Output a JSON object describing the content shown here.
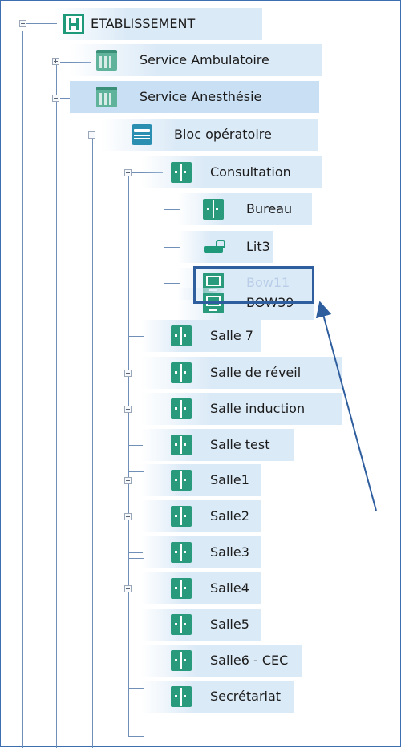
{
  "tree": {
    "root": {
      "label": "ETABLISSEMENT",
      "icon": "hospital-icon"
    },
    "services": [
      {
        "label": "Service Ambulatoire",
        "icon": "building-icon",
        "expanded": false
      },
      {
        "label": "Service Anesthésie",
        "icon": "building-icon",
        "expanded": true
      }
    ],
    "bloc": {
      "label": "Bloc opératoire",
      "icon": "operating-block-icon"
    },
    "consultation": {
      "label": "Consultation",
      "icon": "room-door-icon"
    },
    "consultation_children": [
      {
        "label": "Bureau",
        "icon": "room-door-icon"
      },
      {
        "label": "Lit3",
        "icon": "bed-icon"
      },
      {
        "label": "Bow11",
        "icon": "monitor-icon",
        "state": "greyed-highlighted"
      },
      {
        "label": "BOW39",
        "icon": "monitor-icon"
      }
    ],
    "rooms": [
      {
        "label": "Salle 7",
        "expandable": false
      },
      {
        "label": "Salle de réveil",
        "expandable": true
      },
      {
        "label": "Salle induction",
        "expandable": true
      },
      {
        "label": "Salle test",
        "expandable": false
      },
      {
        "label": "Salle1",
        "expandable": true
      },
      {
        "label": "Salle2",
        "expandable": true
      },
      {
        "label": "Salle3",
        "expandable": false
      },
      {
        "label": "Salle4",
        "expandable": true
      },
      {
        "label": "Salle5",
        "expandable": false
      },
      {
        "label": "Salle6 - CEC",
        "expandable": false
      },
      {
        "label": "Secrétariat",
        "expandable": false
      }
    ]
  },
  "annotation": {
    "target": "Bow11",
    "color": "#2f5e9e"
  },
  "colors": {
    "icon_green": "#1e9a7a",
    "selection": "#c9dff3",
    "tree_line": "#6f8fb8"
  }
}
